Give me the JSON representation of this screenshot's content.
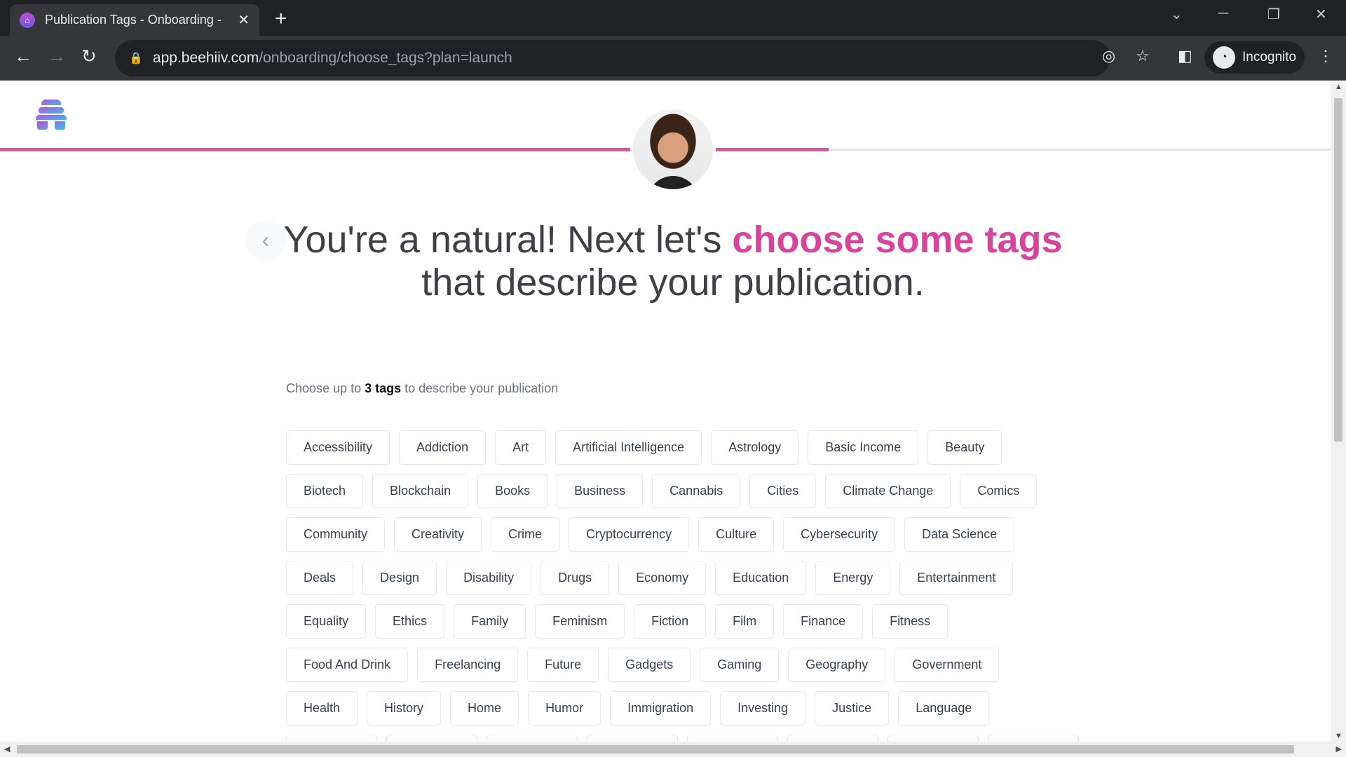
{
  "browser": {
    "tab_title": "Publication Tags - Onboarding -",
    "url_host": "app.beehiiv.com",
    "url_path": "/onboarding/choose_tags?plan=launch",
    "profile": "Incognito"
  },
  "heading": {
    "part1": "You're a natural! Next let's ",
    "highlight": "choose some tags",
    "part2": "that describe your publication."
  },
  "subtext": {
    "before": "Choose up to ",
    "bold": "3 tags",
    "after": " to describe your publication"
  },
  "progress_percent": 62,
  "colors": {
    "accent": "#d9439e",
    "progress": "#e052a4"
  },
  "tag_rows": [
    [
      "Accessibility",
      "Addiction",
      "Art",
      "Artificial Intelligence",
      "Astrology",
      "Basic Income",
      "Beauty"
    ],
    [
      "Biotech",
      "Blockchain",
      "Books",
      "Business",
      "Cannabis",
      "Cities",
      "Climate Change",
      "Comics"
    ],
    [
      "Community",
      "Creativity",
      "Crime",
      "Cryptocurrency",
      "Culture",
      "Cybersecurity",
      "Data Science"
    ],
    [
      "Deals",
      "Design",
      "Disability",
      "Drugs",
      "Economy",
      "Education",
      "Energy",
      "Entertainment"
    ],
    [
      "Equality",
      "Ethics",
      "Family",
      "Feminism",
      "Fiction",
      "Film",
      "Finance",
      "Fitness"
    ],
    [
      "Food And Drink",
      "Freelancing",
      "Future",
      "Gadgets",
      "Gaming",
      "Geography",
      "Government"
    ],
    [
      "Health",
      "History",
      "Home",
      "Humor",
      "Immigration",
      "Investing",
      "Justice",
      "Language"
    ]
  ]
}
